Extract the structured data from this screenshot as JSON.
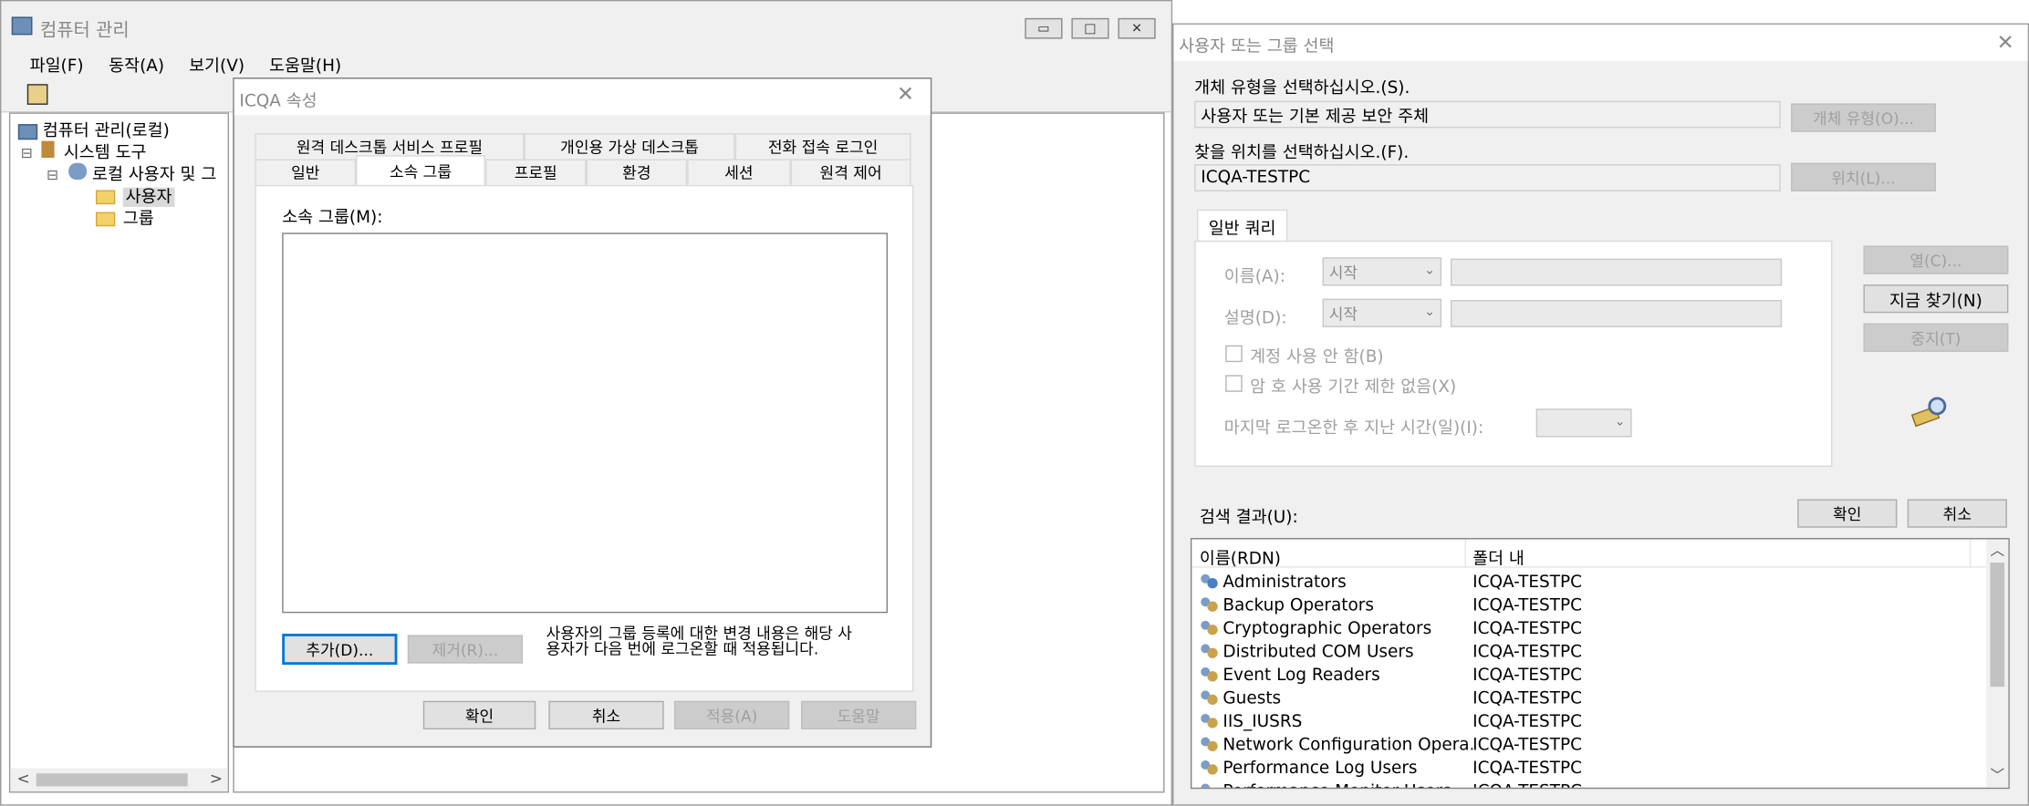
{
  "cm": {
    "title": "컴퓨터 관리",
    "menu": [
      "파일(F)",
      "동작(A)",
      "보기(V)",
      "도움말(H)"
    ],
    "min": "▭",
    "max": "□",
    "close": "✕",
    "tree": {
      "root": "컴퓨터 관리(로컬)",
      "sys": "시스템 도구",
      "local": "로컬 사용자 및 그",
      "users": "사용자",
      "groups": "그룹",
      "exp1": "⊟",
      "exp2": "⊟"
    }
  },
  "prop": {
    "title": "ICQA 속성",
    "tabs_top": [
      "원격 데스크톱 서비스 프로필",
      "개인용 가상 데스크톱",
      "전화 접속 로그인"
    ],
    "tabs_bottom": [
      "일반",
      "소속 그룹",
      "프로필",
      "환경",
      "세션",
      "원격 제어"
    ],
    "member_label": "소속 그룹(M):",
    "add": "추가(D)...",
    "remove": "제거(R)...",
    "note": "사용자의 그룹 등록에 대한 변경 내용은 해당 사용자가 다음 번에 로그온할 때 적용됩니다.",
    "ok": "확인",
    "cancel": "취소",
    "apply": "적용(A)",
    "help": "도움말"
  },
  "sel": {
    "title": "사용자 또는 그룹 선택",
    "obj_type_label": "개체 유형을 선택하십시오.(S).",
    "obj_type_value": "사용자 또는 기본 제공 보안 주체",
    "obj_type_btn": "개체 유형(O)...",
    "loc_label": "찾을 위치를 선택하십시오.(F).",
    "loc_value": "ICQA-TESTPC",
    "loc_btn": "위치(L)...",
    "query_tab": "일반 쿼리",
    "name_label": "이름(A):",
    "desc_label": "설명(D):",
    "starts": "시작",
    "disabled_acct": "계정 사용 안 함(B)",
    "no_expire": "암 호 사용 기간 제한 없음(X)",
    "days_label": "마지막 로그온한 후 지난 시간(일)(I):",
    "columns_btn": "열(C)...",
    "find_btn": "지금 찾기(N)",
    "stop_btn": "중지(T)",
    "results_label": "검색 결과(U):",
    "ok": "확인",
    "cancel": "취소",
    "col_name": "이름(RDN)",
    "col_folder": "폴더 내",
    "rows": [
      {
        "name": "Administrators",
        "folder": "ICQA-TESTPC"
      },
      {
        "name": "Backup Operators",
        "folder": "ICQA-TESTPC"
      },
      {
        "name": "Cryptographic Operators",
        "folder": "ICQA-TESTPC"
      },
      {
        "name": "Distributed COM Users",
        "folder": "ICQA-TESTPC"
      },
      {
        "name": "Event Log Readers",
        "folder": "ICQA-TESTPC"
      },
      {
        "name": "Guests",
        "folder": "ICQA-TESTPC"
      },
      {
        "name": "IIS_IUSRS",
        "folder": "ICQA-TESTPC"
      },
      {
        "name": "Network Configuration Opera...",
        "folder": "ICQA-TESTPC"
      },
      {
        "name": "Performance Log Users",
        "folder": "ICQA-TESTPC"
      },
      {
        "name": "Performance Monitor Users",
        "folder": "ICQA-TESTPC"
      }
    ]
  }
}
